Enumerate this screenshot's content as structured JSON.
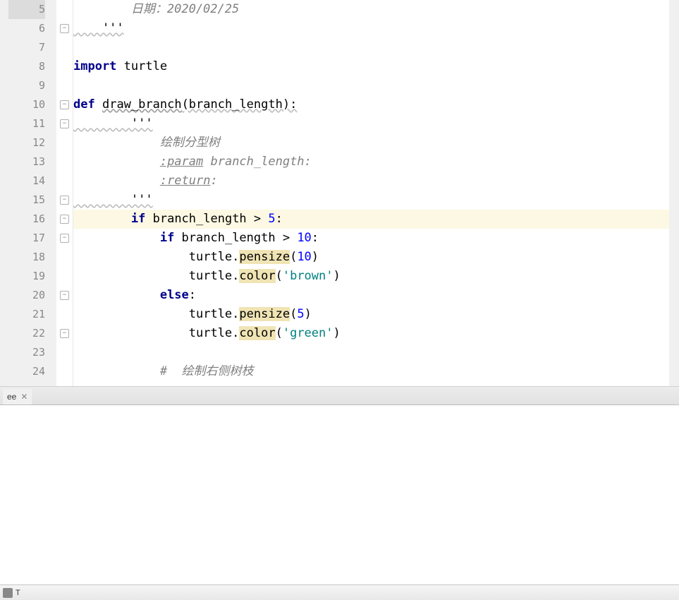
{
  "editor": {
    "current_line": 16,
    "lines": [
      {
        "num": 5,
        "modified": true,
        "fold": "",
        "segs": [
          {
            "t": "        日期：2020/02/25",
            "cls": "cmt"
          }
        ]
      },
      {
        "num": 6,
        "fold": "close",
        "segs": [
          {
            "t": "    '''",
            "cls": "wavy-light"
          }
        ]
      },
      {
        "num": 7,
        "fold": "",
        "segs": []
      },
      {
        "num": 8,
        "fold": "",
        "segs": [
          {
            "t": "import",
            "cls": "kw"
          },
          {
            "t": " "
          },
          {
            "t": "turtle"
          }
        ]
      },
      {
        "num": 9,
        "fold": "",
        "segs": []
      },
      {
        "num": 10,
        "fold": "open",
        "segs": [
          {
            "t": "def",
            "cls": "kw"
          },
          {
            "t": " "
          },
          {
            "t": "draw_branch",
            "cls": "wavy"
          },
          {
            "t": "(branch_length):",
            "cls": "wavy-light"
          }
        ]
      },
      {
        "num": 11,
        "fold": "open",
        "segs": [
          {
            "t": "        '''",
            "cls": "wavy-light"
          }
        ]
      },
      {
        "num": 12,
        "fold": "",
        "segs": [
          {
            "t": "            绘制分型树",
            "cls": "cmt"
          }
        ]
      },
      {
        "num": 13,
        "fold": "",
        "segs": [
          {
            "t": "            ",
            "cls": ""
          },
          {
            "t": ":param",
            "cls": "tag"
          },
          {
            "t": " branch_length:",
            "cls": "param"
          }
        ]
      },
      {
        "num": 14,
        "fold": "",
        "segs": [
          {
            "t": "            ",
            "cls": ""
          },
          {
            "t": ":return",
            "cls": "tag"
          },
          {
            "t": ":",
            "cls": "param"
          }
        ]
      },
      {
        "num": 15,
        "fold": "close",
        "segs": [
          {
            "t": "        '''",
            "cls": "wavy-light"
          }
        ]
      },
      {
        "num": 16,
        "fold": "open",
        "current": true,
        "segs": [
          {
            "t": "        "
          },
          {
            "t": "if",
            "cls": "kw"
          },
          {
            "t": " branch_length > "
          },
          {
            "t": "5",
            "cls": "num"
          },
          {
            "t": ":"
          }
        ]
      },
      {
        "num": 17,
        "fold": "open",
        "segs": [
          {
            "t": "            "
          },
          {
            "t": "if",
            "cls": "kw"
          },
          {
            "t": " branch_length > "
          },
          {
            "t": "10",
            "cls": "num"
          },
          {
            "t": ":"
          }
        ]
      },
      {
        "num": 18,
        "fold": "",
        "segs": [
          {
            "t": "                turtle."
          },
          {
            "t": "pensize",
            "cls": "hl"
          },
          {
            "t": "("
          },
          {
            "t": "10",
            "cls": "num"
          },
          {
            "t": ")"
          }
        ]
      },
      {
        "num": 19,
        "fold": "",
        "segs": [
          {
            "t": "                turtle."
          },
          {
            "t": "color",
            "cls": "hl"
          },
          {
            "t": "("
          },
          {
            "t": "'brown'",
            "cls": "str"
          },
          {
            "t": ")"
          }
        ]
      },
      {
        "num": 20,
        "fold": "open",
        "segs": [
          {
            "t": "            "
          },
          {
            "t": "else",
            "cls": "kw"
          },
          {
            "t": ":"
          }
        ]
      },
      {
        "num": 21,
        "fold": "",
        "segs": [
          {
            "t": "                turtle."
          },
          {
            "t": "pensize",
            "cls": "hl"
          },
          {
            "t": "("
          },
          {
            "t": "5",
            "cls": "num"
          },
          {
            "t": ")"
          }
        ]
      },
      {
        "num": 22,
        "fold": "close",
        "segs": [
          {
            "t": "                turtle."
          },
          {
            "t": "color",
            "cls": "hl"
          },
          {
            "t": "("
          },
          {
            "t": "'green'",
            "cls": "str"
          },
          {
            "t": ")"
          }
        ]
      },
      {
        "num": 23,
        "fold": "",
        "segs": []
      },
      {
        "num": 24,
        "fold": "",
        "segs": [
          {
            "t": "            "
          },
          {
            "t": "#  绘制右侧树枝",
            "cls": "cmt"
          }
        ]
      }
    ]
  },
  "tab_strip": {
    "tab_label": "ee",
    "close": "✕"
  },
  "status_bar": {
    "label": "T"
  }
}
